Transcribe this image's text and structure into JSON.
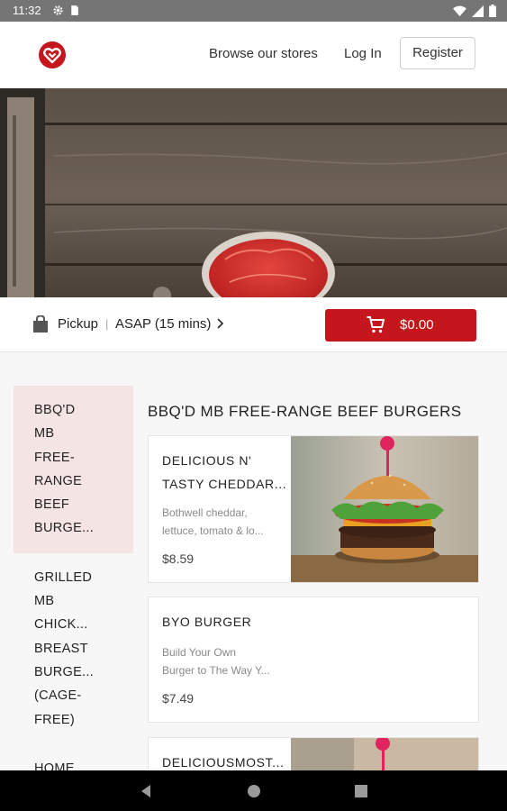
{
  "status": {
    "time": "11:32",
    "icons": [
      "gear-icon",
      "sd-card-icon",
      "wifi-icon",
      "signal-icon",
      "battery-icon"
    ]
  },
  "nav": {
    "browse": "Browse our stores",
    "login": "Log In",
    "register": "Register"
  },
  "order": {
    "mode": "Pickup",
    "separator": "|",
    "time": "ASAP (15 mins)",
    "cart_total": "$0.00"
  },
  "sidebar": {
    "categories": [
      {
        "lines": [
          "BBQ'D",
          "MB",
          "FREE-",
          "RANGE",
          "BEEF",
          "BURGE..."
        ]
      },
      {
        "lines": [
          "GRILLED",
          "MB",
          "CHICK...",
          "BREAST",
          "BURGE...",
          "(CAGE-",
          "FREE)"
        ]
      },
      {
        "lines": [
          "HOME..."
        ]
      }
    ]
  },
  "menu": {
    "section_title": "BBQ'D MB FREE-RANGE BEEF BURGERS",
    "items": [
      {
        "name": [
          "DELICIOUS N'",
          "TASTY CHEDDAR..."
        ],
        "desc": [
          "Bothwell cheddar,",
          "lettuce, tomato & lo..."
        ],
        "price": "$8.59"
      },
      {
        "name": [
          "BYO BURGER"
        ],
        "desc": [
          "Build Your Own",
          "Burger to The Way Y..."
        ],
        "price": "$7.49"
      },
      {
        "name": [
          "DELICIOUSMOST..."
        ]
      }
    ]
  },
  "colors": {
    "brand": "#c4161c",
    "active_category_bg": "#f4e4e4"
  }
}
